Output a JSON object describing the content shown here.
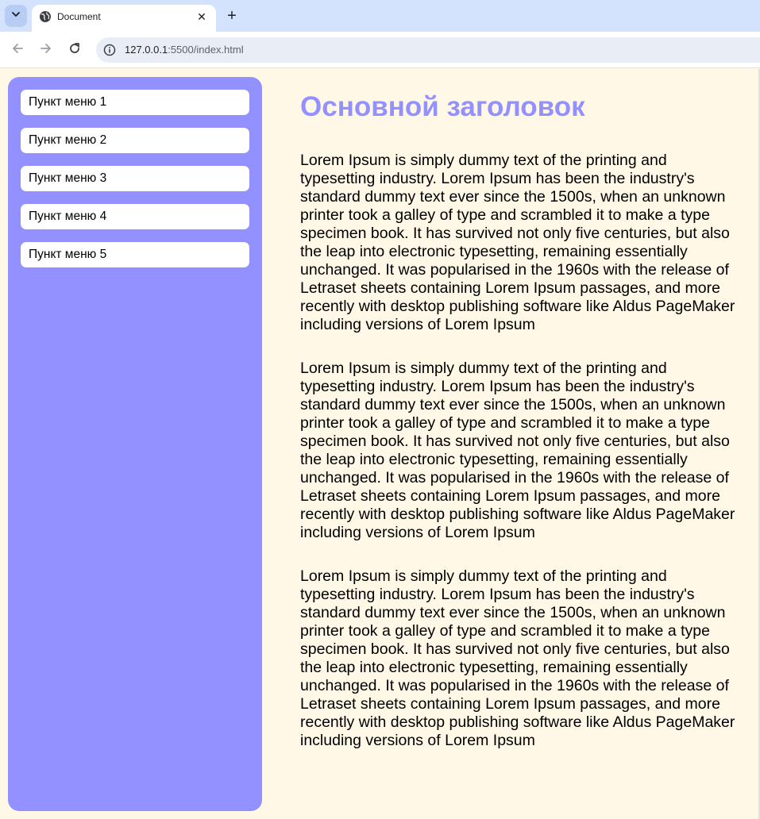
{
  "browser": {
    "tab_title": "Document",
    "new_tab_symbol": "+",
    "close_symbol": "✕",
    "url_host": "127.0.0.1",
    "url_rest": ":5500/index.html",
    "icons": [
      "chevron-down-icon",
      "globe-icon",
      "back-arrow-icon",
      "forward-arrow-icon",
      "reload-icon",
      "info-icon"
    ]
  },
  "sidebar": {
    "background": "#9391ff",
    "items": [
      {
        "label": "Пункт меню 1"
      },
      {
        "label": "Пункт меню 2"
      },
      {
        "label": "Пункт меню 3"
      },
      {
        "label": "Пункт меню 4"
      },
      {
        "label": "Пункт меню 5"
      }
    ]
  },
  "main": {
    "title": "Основной заголовок",
    "title_color": "#9391ff",
    "background": "#fff8e7",
    "paragraphs": [
      "Lorem Ipsum is simply dummy text of the printing and typesetting industry. Lorem Ipsum has been the industry's standard dummy text ever since the 1500s, when an unknown printer took a galley of type and scrambled it to make a type specimen book. It has survived not only five centuries, but also the leap into electronic typesetting, remaining essentially unchanged. It was popularised in the 1960s with the release of Letraset sheets containing Lorem Ipsum passages, and more recently with desktop publishing software like Aldus PageMaker including versions of Lorem Ipsum",
      "Lorem Ipsum is simply dummy text of the printing and typesetting industry. Lorem Ipsum has been the industry's standard dummy text ever since the 1500s, when an unknown printer took a galley of type and scrambled it to make a type specimen book. It has survived not only five centuries, but also the leap into electronic typesetting, remaining essentially unchanged. It was popularised in the 1960s with the release of Letraset sheets containing Lorem Ipsum passages, and more recently with desktop publishing software like Aldus PageMaker including versions of Lorem Ipsum",
      "Lorem Ipsum is simply dummy text of the printing and typesetting industry. Lorem Ipsum has been the industry's standard dummy text ever since the 1500s, when an unknown printer took a galley of type and scrambled it to make a type specimen book. It has survived not only five centuries, but also the leap into electronic typesetting, remaining essentially unchanged. It was popularised in the 1960s with the release of Letraset sheets containing Lorem Ipsum passages, and more recently with desktop publishing software like Aldus PageMaker including versions of Lorem Ipsum"
    ]
  }
}
